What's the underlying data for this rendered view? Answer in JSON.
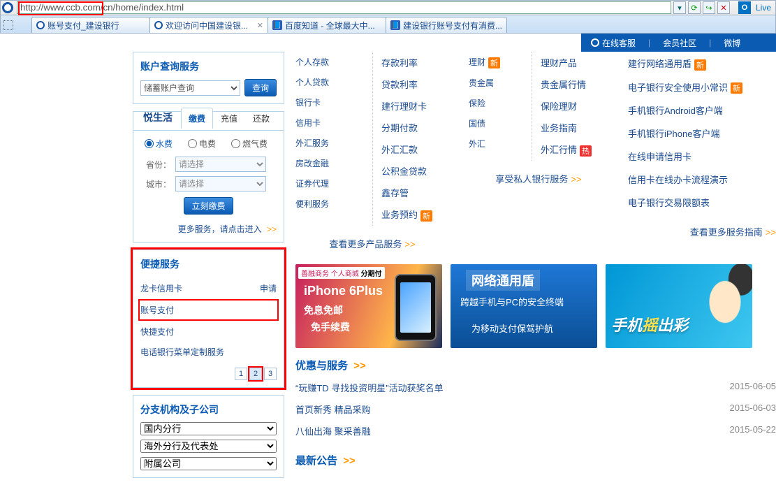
{
  "url": "http://www.ccb.com/cn/home/index.html",
  "live_label": "Live",
  "browser_tabs": [
    {
      "label": "账号支付_建设银行"
    },
    {
      "label": "欢迎访问中国建设银..."
    },
    {
      "label": "百度知道 - 全球最大中..."
    },
    {
      "label": "建设银行账号支付有消费..."
    }
  ],
  "cust_bar": {
    "service": "在线客服",
    "community": "会员社区",
    "weibo": "微博"
  },
  "query_box": {
    "title": "账户查询服务",
    "select": "储蓄账户查询",
    "btn": "查询"
  },
  "life_box": {
    "title": "悦生活",
    "tabs": [
      "缴费",
      "充值",
      "还款"
    ],
    "radios": [
      "水费",
      "电费",
      "燃气费"
    ],
    "province_lbl": "省份：",
    "city_lbl": "城市：",
    "placeholder": "请选择",
    "submit": "立刻缴费",
    "more": "更多服务，请点击进入"
  },
  "convenient": {
    "title": "便捷服务",
    "items": [
      {
        "name": "龙卡信用卡",
        "action": "申请"
      },
      {
        "name": "账号支付",
        "action": ""
      },
      {
        "name": "快捷支付",
        "action": ""
      },
      {
        "name": "电话银行菜单定制服务",
        "action": ""
      }
    ],
    "pages": [
      "1",
      "2",
      "3"
    ]
  },
  "branch_box": {
    "title": "分支机构及子公司",
    "selects": [
      "国内分行",
      "海外分行及代表处",
      "附属公司"
    ]
  },
  "products": {
    "col1": [
      {
        "n": "个人存款",
        "s": "存款利率"
      },
      {
        "n": "个人贷款",
        "s": "贷款利率"
      },
      {
        "n": "银行卡",
        "s": "建行理财卡"
      },
      {
        "n": "信用卡",
        "s": "分期付款"
      },
      {
        "n": "外汇服务",
        "s": "外汇汇款"
      },
      {
        "n": "房改金融",
        "s": "公积金贷款"
      },
      {
        "n": "证券代理",
        "s": "鑫存管"
      },
      {
        "n": "便利服务",
        "s": "业务预约",
        "badge": "新"
      }
    ],
    "col1_more": "查看更多产品服务",
    "col2": [
      {
        "n": "理财",
        "s": "理财产品",
        "badge": "新"
      },
      {
        "n": "贵金属",
        "s": "贵金属行情"
      },
      {
        "n": "保险",
        "s": "保险理财"
      },
      {
        "n": "国债",
        "s": "业务指南"
      },
      {
        "n": "外汇",
        "s": "外汇行情",
        "badge2": "热"
      }
    ],
    "col2_more": "享受私人银行服务"
  },
  "rightlinks": [
    {
      "t": "建行网络通用盾",
      "b": "新"
    },
    {
      "t": "电子银行安全使用小常识",
      "b": "新"
    },
    {
      "t": "手机银行Android客户端"
    },
    {
      "t": "手机银行iPhone客户端"
    },
    {
      "t": "在线申请信用卡"
    },
    {
      "t": "信用卡在线办卡流程演示"
    },
    {
      "t": "电子银行交易限额表"
    }
  ],
  "right_more": "查看更多服务指南",
  "banner1": {
    "tag": "善融商务 个人商城",
    "sub": "分期付",
    "big": "iPhone 6Plus",
    "l2": "免息免邮",
    "l3": "免手续费"
  },
  "banner2": {
    "ttl": "网络通用盾",
    "l2": "跨越手机与PC的安全终端",
    "l3": "为移动支付保驾护航"
  },
  "banner3": {
    "l1a": "手机",
    "l1b": "摇",
    "l1c": "出彩"
  },
  "news": {
    "title": "优惠与服务",
    "items": [
      {
        "t": "“玩赚TD 寻找投资明星”活动获奖名单",
        "d": "2015-06-05"
      },
      {
        "t": "首页新秀 精品采购",
        "d": "2015-06-03"
      },
      {
        "t": "八仙出海 聚采善融",
        "d": "2015-05-22"
      }
    ],
    "notice": "最新公告"
  },
  "arrow": ">>"
}
